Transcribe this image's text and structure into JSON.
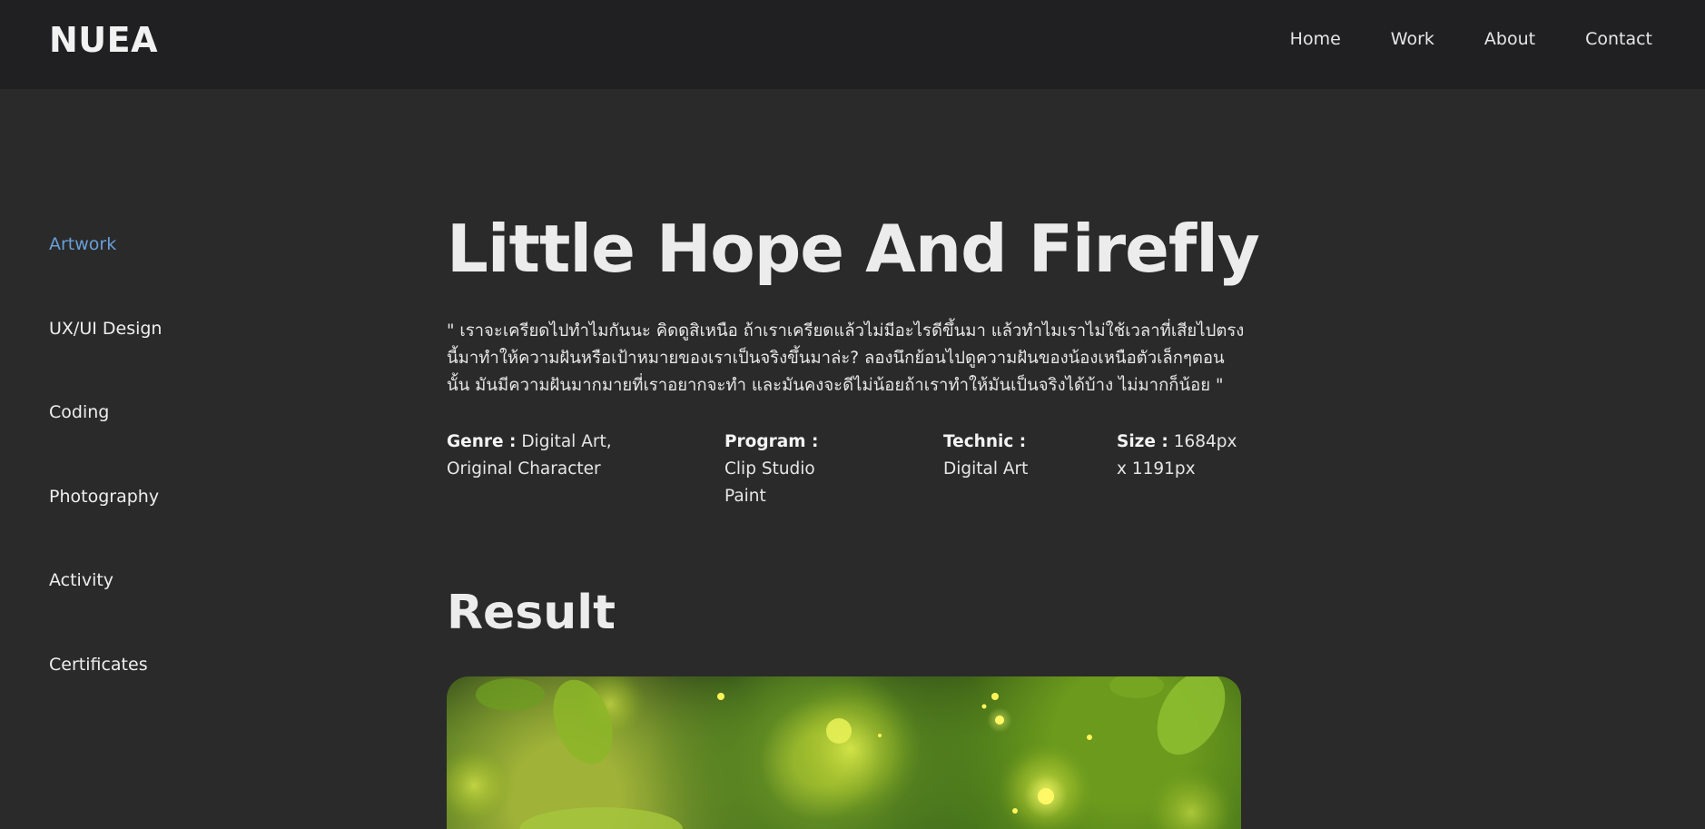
{
  "header": {
    "logo": "NUEA",
    "nav": [
      "Home",
      "Work",
      "About",
      "Contact"
    ]
  },
  "sidebar": {
    "items": [
      {
        "label": "Artwork",
        "active": true
      },
      {
        "label": "UX/UI Design",
        "active": false
      },
      {
        "label": "Coding",
        "active": false
      },
      {
        "label": "Photography",
        "active": false
      },
      {
        "label": "Activity",
        "active": false
      },
      {
        "label": "Certificates",
        "active": false
      }
    ]
  },
  "main": {
    "title": "Little Hope And Firefly",
    "quote": "\" เราจะเครียดไปทำไมกันนะ คิดดูสิเหนือ ถ้าเราเครียดแล้วไม่มีอะไรดีขึ้นมา แล้วทำไมเราไม่ใช้เวลาที่เสียไปตรงนี้มาทำให้ความฝันหรือเป้าหมายของเราเป็นจริงขึ้นมาล่ะ? ลองนึกย้อนไปดูความฝันของน้องเหนือตัวเล็กๆตอนนั้น มันมีความฝันมากมายที่เราอยากจะทำ และมันคงจะดีไม่น้อยถ้าเราทำให้มันเป็นจริงได้บ้าง ไม่มากก็น้อย \"",
    "meta": [
      {
        "key": "Genre :",
        "value": "Digital Art, Original Character"
      },
      {
        "key": "Program :",
        "value": "Clip Studio Paint"
      },
      {
        "key": "Technic :",
        "value": "Digital Art"
      },
      {
        "key": "Size :",
        "value": "1684px x 1191px"
      }
    ],
    "result_heading": "Result"
  },
  "colors": {
    "background": "#2a2a2a",
    "topbar": "#202023",
    "accent": "#6a9fd8"
  }
}
